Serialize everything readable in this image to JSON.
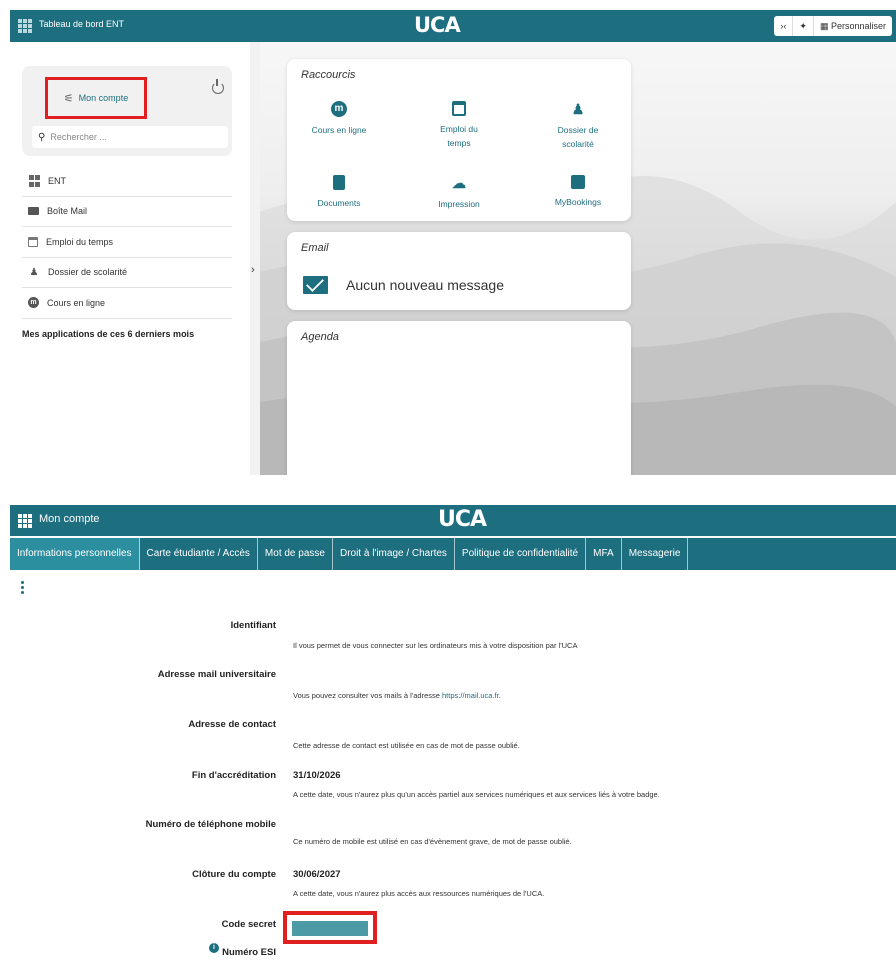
{
  "top": {
    "header": {
      "title": "Tableau de bord ENT",
      "logo": "UCA",
      "tools": {
        "collapse": "›‹",
        "sparkle": "✦",
        "personalize": "Personnaliser"
      }
    },
    "sidebar": {
      "account_label": "Mon compte",
      "search_placeholder": "Rechercher ...",
      "items": [
        {
          "label": "ENT",
          "icon": "dashboard-icon"
        },
        {
          "label": "Boîte Mail",
          "icon": "mail-icon"
        },
        {
          "label": "Emploi du temps",
          "icon": "calendar-icon"
        },
        {
          "label": "Dossier de scolarité",
          "icon": "student-icon"
        },
        {
          "label": "Cours en ligne",
          "icon": "moodle-icon"
        }
      ],
      "apps_heading": "Mes applications de ces 6 derniers mois"
    },
    "shortcuts": {
      "title": "Raccourcis",
      "items": [
        {
          "line1": "Cours en ligne",
          "line2": "",
          "icon": "moodle-icon"
        },
        {
          "line1": "Emploi du",
          "line2": "temps",
          "icon": "calendar-icon"
        },
        {
          "line1": "Dossier de",
          "line2": "scolarité",
          "icon": "student-icon"
        },
        {
          "line1": "Documents",
          "line2": "",
          "icon": "document-icon"
        },
        {
          "line1": "Impression",
          "line2": "",
          "icon": "cloud-print-icon"
        },
        {
          "line1": "MyBookings",
          "line2": "",
          "icon": "bookmark-icon"
        }
      ]
    },
    "email": {
      "title": "Email",
      "message": "Aucun nouveau message"
    },
    "agenda": {
      "title": "Agenda"
    }
  },
  "bottom": {
    "header": {
      "title": "Mon compte",
      "logo": "UCA"
    },
    "tabs": [
      "Informations personnelles",
      "Carte étudiante / Accès",
      "Mot de passe",
      "Droit à l'image / Chartes",
      "Politique de confidentialité",
      "MFA",
      "Messagerie"
    ],
    "fields": {
      "identifiant": {
        "label": "Identifiant",
        "help": "Il vous permet de vous connecter sur les ordinateurs mis à votre disposition par l'UCA"
      },
      "mail": {
        "label": "Adresse mail universitaire",
        "help_before": "Vous pouvez consulter vos mails à l'adresse ",
        "help_link": "https://mail.uca.fr",
        "help_after": "."
      },
      "contact": {
        "label": "Adresse de contact",
        "help": "Cette adresse de contact est utilisée en cas de mot de passe oublié."
      },
      "accreditation": {
        "label": "Fin d'accréditation",
        "value": "31/10/2026",
        "help": "A cette date, vous n'aurez plus qu'un accès partiel aux services numériques et aux services liés à votre badge."
      },
      "phone": {
        "label": "Numéro de téléphone mobile",
        "help": "Ce numéro de mobile est utilisé en cas d'évènement grave, de mot de passe oublié."
      },
      "closure": {
        "label": "Clôture du compte",
        "value": "30/06/2027",
        "help": "A cette date, vous n'aurez plus accès aux ressources numériques de l'UCA."
      },
      "secret": {
        "label": "Code secret"
      },
      "esi": {
        "label": "Numéro ESI"
      }
    }
  },
  "colors": {
    "brand": "#1d6e7e",
    "highlight": "#e02020",
    "tab_active": "#2b8fa0"
  }
}
